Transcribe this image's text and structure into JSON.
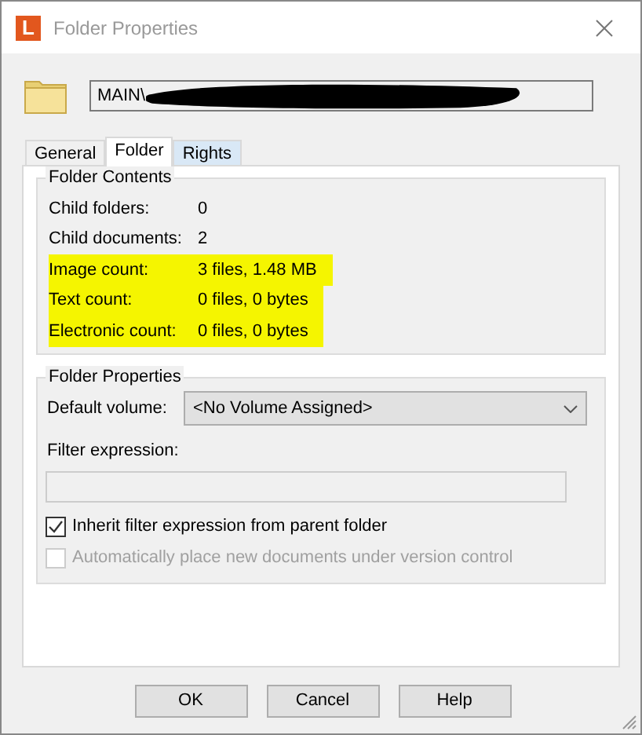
{
  "window": {
    "title": "Folder Properties",
    "app_icon_letter": "L"
  },
  "path_field": {
    "value": "MAIN\\",
    "redacted": true
  },
  "tabs": [
    {
      "label": "General",
      "selected": false
    },
    {
      "label": "Folder",
      "selected": true
    },
    {
      "label": "Rights",
      "selected": false
    }
  ],
  "folder_contents": {
    "title": "Folder Contents",
    "rows": [
      {
        "label": "Child folders:",
        "value": "0",
        "highlighted": false
      },
      {
        "label": "Child documents:",
        "value": "2",
        "highlighted": false
      },
      {
        "label": "Image count:",
        "value": "3 files, 1.48 MB",
        "highlighted": true
      },
      {
        "label": "Text count:",
        "value": "0 files, 0 bytes",
        "highlighted": true
      },
      {
        "label": "Electronic count:",
        "value": "0 files, 0 bytes",
        "highlighted": true
      }
    ]
  },
  "folder_properties": {
    "title": "Folder Properties",
    "default_volume_label": "Default volume:",
    "default_volume": "<No Volume Assigned>",
    "filter_label": "Filter expression:",
    "checkboxes": [
      {
        "label": "Inherit filter expression from parent folder",
        "checked": true,
        "disabled": false
      },
      {
        "label": "Automatically place new documents under version control",
        "checked": false,
        "disabled": true
      }
    ]
  },
  "buttons": [
    "OK",
    "Cancel",
    "Help"
  ]
}
